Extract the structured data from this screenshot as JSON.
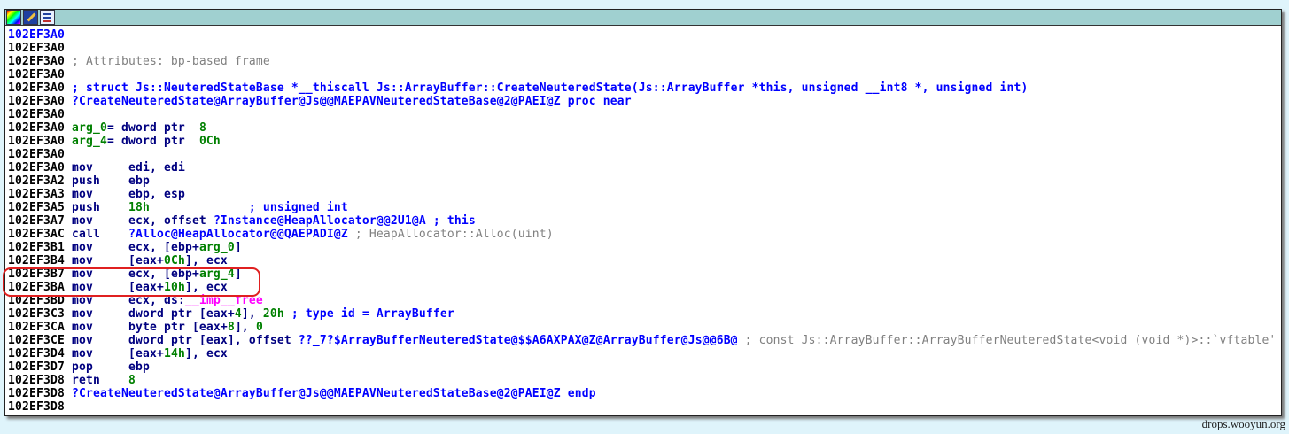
{
  "toolbar": {
    "icons": [
      "color-palette-icon",
      "edit-pencil-icon",
      "graph-view-icon"
    ]
  },
  "lines": [
    {
      "addr": "102EF3A0",
      "parts": []
    },
    {
      "addr": "102EF3A0",
      "parts": []
    },
    {
      "addr": "102EF3A0",
      "parts": [
        [
          " ; Attributes: bp-based frame",
          "cm"
        ]
      ]
    },
    {
      "addr": "102EF3A0",
      "parts": []
    },
    {
      "addr": "102EF3A0",
      "parts": [
        [
          " ; struct Js::NeuteredStateBase *__thiscall Js::ArrayBuffer::CreateNeuteredState(Js::ArrayBuffer *this, unsigned __int8 *, unsigned int)",
          "nm"
        ]
      ]
    },
    {
      "addr": "102EF3A0",
      "parts": [
        [
          " ?CreateNeuteredState@ArrayBuffer@Js@@MAEPAVNeuteredStateBase@2@PAEI@Z proc near",
          "nm"
        ]
      ]
    },
    {
      "addr": "102EF3A0",
      "parts": []
    },
    {
      "addr": "102EF3A0",
      "parts": [
        [
          " arg_0",
          "num"
        ],
        [
          "= dword ptr  ",
          "op"
        ],
        [
          "8",
          "num"
        ]
      ]
    },
    {
      "addr": "102EF3A0",
      "parts": [
        [
          " arg_4",
          "num"
        ],
        [
          "= dword ptr  ",
          "op"
        ],
        [
          "0Ch",
          "num"
        ]
      ]
    },
    {
      "addr": "102EF3A0",
      "parts": []
    },
    {
      "addr": "102EF3A0",
      "parts": [
        [
          " mov     ",
          "mn"
        ],
        [
          "edi, edi",
          "op"
        ]
      ]
    },
    {
      "addr": "102EF3A2",
      "parts": [
        [
          " push    ",
          "mn"
        ],
        [
          "ebp",
          "op"
        ]
      ]
    },
    {
      "addr": "102EF3A3",
      "parts": [
        [
          " mov     ",
          "mn"
        ],
        [
          "ebp, esp",
          "op"
        ]
      ]
    },
    {
      "addr": "102EF3A5",
      "parts": [
        [
          " push    ",
          "mn"
        ],
        [
          "18h",
          "num"
        ],
        [
          "              ; unsigned int",
          "cmb"
        ]
      ]
    },
    {
      "addr": "102EF3A7",
      "parts": [
        [
          " mov     ",
          "mn"
        ],
        [
          "ecx, offset ",
          "op"
        ],
        [
          "?Instance@HeapAllocator@@2U1@A",
          "nm"
        ],
        [
          " ; this",
          "cmb"
        ]
      ]
    },
    {
      "addr": "102EF3AC",
      "parts": [
        [
          " call    ",
          "mn"
        ],
        [
          "?Alloc@HeapAllocator@@QAEPADI@Z",
          "nm"
        ],
        [
          " ; HeapAllocator::Alloc(uint)",
          "cm"
        ]
      ]
    },
    {
      "addr": "102EF3B1",
      "parts": [
        [
          " mov     ",
          "mn"
        ],
        [
          "ecx, [ebp+",
          "op"
        ],
        [
          "arg_0",
          "num"
        ],
        [
          "]",
          "op"
        ]
      ]
    },
    {
      "addr": "102EF3B4",
      "parts": [
        [
          " mov     ",
          "mn"
        ],
        [
          "[eax+",
          "op"
        ],
        [
          "0Ch",
          "num"
        ],
        [
          "], ecx",
          "op"
        ]
      ]
    },
    {
      "addr": "102EF3B7",
      "parts": [
        [
          " mov     ",
          "mn"
        ],
        [
          "ecx, [ebp+",
          "op"
        ],
        [
          "arg_4",
          "num"
        ],
        [
          "]",
          "op"
        ]
      ]
    },
    {
      "addr": "102EF3BA",
      "parts": [
        [
          " mov     ",
          "mn"
        ],
        [
          "[eax+",
          "op"
        ],
        [
          "10h",
          "num"
        ],
        [
          "], ecx",
          "op"
        ]
      ]
    },
    {
      "addr": "102EF3BD",
      "parts": [
        [
          " mov     ",
          "mn"
        ],
        [
          "ecx, ds:",
          "op"
        ],
        [
          "__imp__free",
          "imp"
        ]
      ]
    },
    {
      "addr": "102EF3C3",
      "parts": [
        [
          " mov     ",
          "mn"
        ],
        [
          "dword ptr [eax+",
          "op"
        ],
        [
          "4",
          "num"
        ],
        [
          "], ",
          "op"
        ],
        [
          "20h",
          "num"
        ],
        [
          " ; type id = ArrayBuffer",
          "cmb"
        ]
      ]
    },
    {
      "addr": "102EF3CA",
      "parts": [
        [
          " mov     ",
          "mn"
        ],
        [
          "byte ptr [eax+",
          "op"
        ],
        [
          "8",
          "num"
        ],
        [
          "], ",
          "op"
        ],
        [
          "0",
          "num"
        ]
      ]
    },
    {
      "addr": "102EF3CE",
      "parts": [
        [
          " mov     ",
          "mn"
        ],
        [
          "dword ptr [eax], offset ",
          "op"
        ],
        [
          "??_7?$ArrayBufferNeuteredState@$$A6AXPAX@Z@ArrayBuffer@Js@@6B@",
          "nm"
        ],
        [
          " ; const Js::ArrayBuffer::ArrayBufferNeuteredState<void (void *)>::`vftable'",
          "cm"
        ]
      ]
    },
    {
      "addr": "102EF3D4",
      "parts": [
        [
          " mov     ",
          "mn"
        ],
        [
          "[eax+",
          "op"
        ],
        [
          "14h",
          "num"
        ],
        [
          "], ecx",
          "op"
        ]
      ]
    },
    {
      "addr": "102EF3D7",
      "parts": [
        [
          " pop     ",
          "mn"
        ],
        [
          "ebp",
          "op"
        ]
      ]
    },
    {
      "addr": "102EF3D8",
      "parts": [
        [
          " retn    ",
          "mn"
        ],
        [
          "8",
          "num"
        ]
      ]
    },
    {
      "addr": "102EF3D8",
      "parts": [
        [
          " ?CreateNeuteredState@ArrayBuffer@Js@@MAEPAVNeuteredStateBase@2@PAEI@Z endp",
          "nm"
        ]
      ]
    },
    {
      "addr": "102EF3D8",
      "parts": []
    }
  ],
  "watermark": "drops.wooyun.org",
  "colors": {
    "titlebar": "#a0d0d0",
    "highlight": "#e02020",
    "background": "#dff4fb"
  }
}
